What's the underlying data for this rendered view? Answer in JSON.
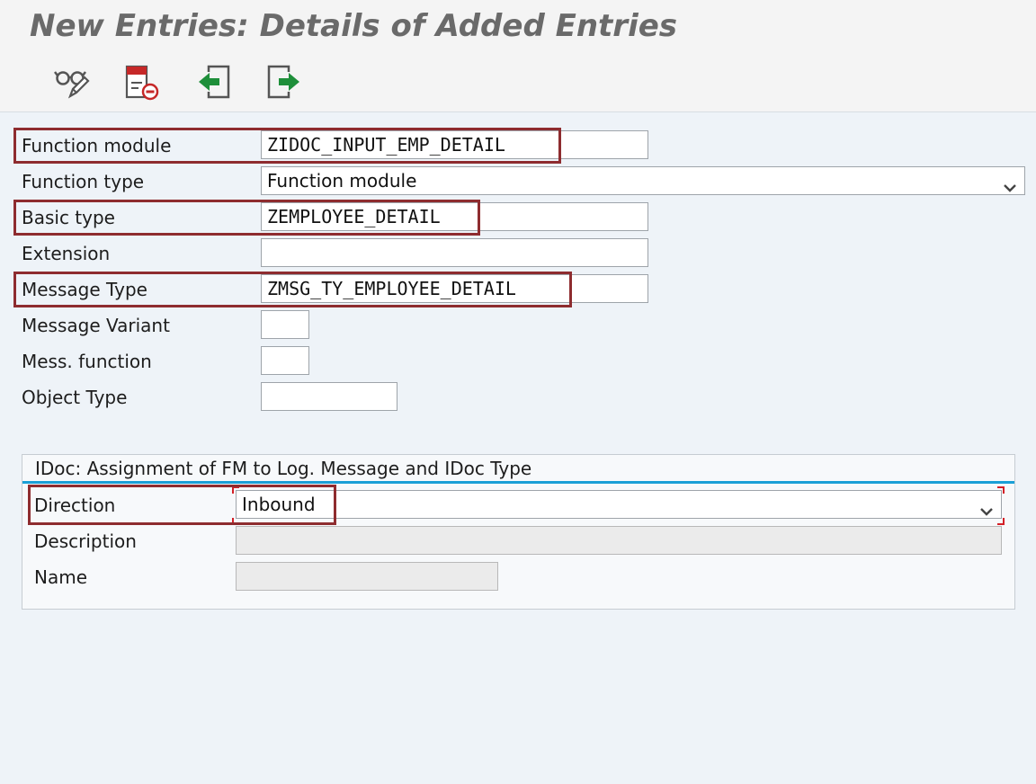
{
  "header": {
    "title": "New Entries: Details of Added Entries"
  },
  "toolbar": {
    "buttons": [
      {
        "name": "display-change",
        "icon": "glasses-pencil-icon"
      },
      {
        "name": "delete",
        "icon": "delete-entry-icon"
      },
      {
        "name": "previous-entry",
        "icon": "previous-entry-icon"
      },
      {
        "name": "next-entry",
        "icon": "next-entry-icon"
      }
    ]
  },
  "form": {
    "function_module": {
      "label": "Function module",
      "value": "ZIDOC_INPUT_EMP_DETAIL"
    },
    "function_type": {
      "label": "Function type",
      "value": "Function module"
    },
    "basic_type": {
      "label": "Basic type",
      "value": "ZEMPLOYEE_DETAIL"
    },
    "extension": {
      "label": "Extension",
      "value": ""
    },
    "message_type": {
      "label": "Message Type",
      "value": "ZMSG_TY_EMPLOYEE_DETAIL"
    },
    "message_variant": {
      "label": "Message Variant",
      "value": ""
    },
    "mess_function": {
      "label": "Mess. function",
      "value": ""
    },
    "object_type": {
      "label": "Object Type",
      "value": ""
    }
  },
  "idoc_group": {
    "title": "IDoc: Assignment of FM to Log. Message and IDoc Type",
    "direction": {
      "label": "Direction",
      "value": "Inbound"
    },
    "description": {
      "label": "Description",
      "value": ""
    },
    "name": {
      "label": "Name",
      "value": ""
    }
  },
  "colors": {
    "highlight": "#8e2c2f",
    "group_rule": "#1a9fd6",
    "background": "#eef3f8"
  }
}
